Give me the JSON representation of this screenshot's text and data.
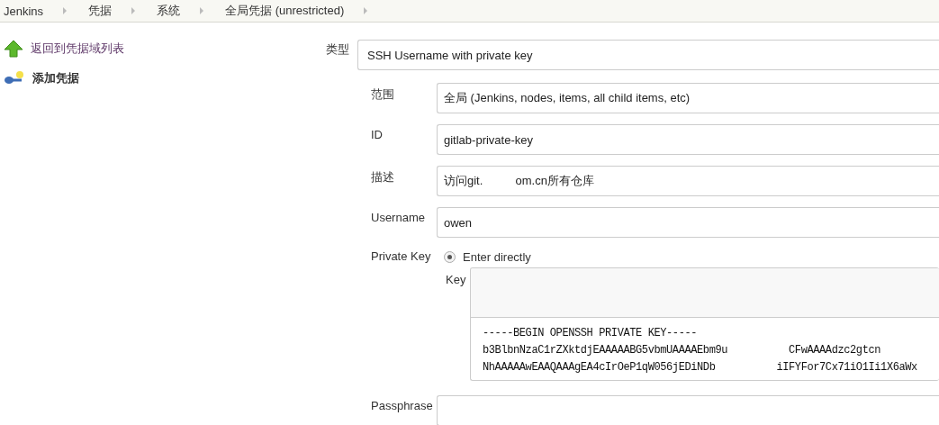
{
  "breadcrumbs": [
    "Jenkins",
    "凭据",
    "系统",
    "全局凭据 (unrestricted)"
  ],
  "sidebar": [
    {
      "label": "返回到凭据域列表",
      "kind": "up",
      "selected": false
    },
    {
      "label": "添加凭据",
      "kind": "key",
      "selected": true
    }
  ],
  "form": {
    "kind": {
      "label": "类型",
      "value": "SSH Username with private key"
    },
    "fields": [
      {
        "label": "范围",
        "value": "全局 (Jenkins, nodes, items, all child items, etc)"
      },
      {
        "label": "ID",
        "value": "gitlab-private-key"
      },
      {
        "label": "描述",
        "value": "访问git.          om.cn所有仓库"
      },
      {
        "label": "Username",
        "value": "owen"
      }
    ],
    "private_key": {
      "label": "Private Key",
      "option": {
        "label": "Enter directly",
        "selected": true
      },
      "key_label": "Key",
      "key_lines": [
        "-----BEGIN OPENSSH PRIVATE KEY-----",
        "b3BlbnNzaC1rZXktdjEAAAAABG5vbmUAAAAEbm9u          CFwAAAAdzc2gtcn",
        "NhAAAAAwEAAQAAAgEA4cIrOeP1qW056jEDiNDb          iIFYFor7Cx71iO1Ii1X6aWx"
      ]
    },
    "passphrase": {
      "label": "Passphrase"
    }
  }
}
